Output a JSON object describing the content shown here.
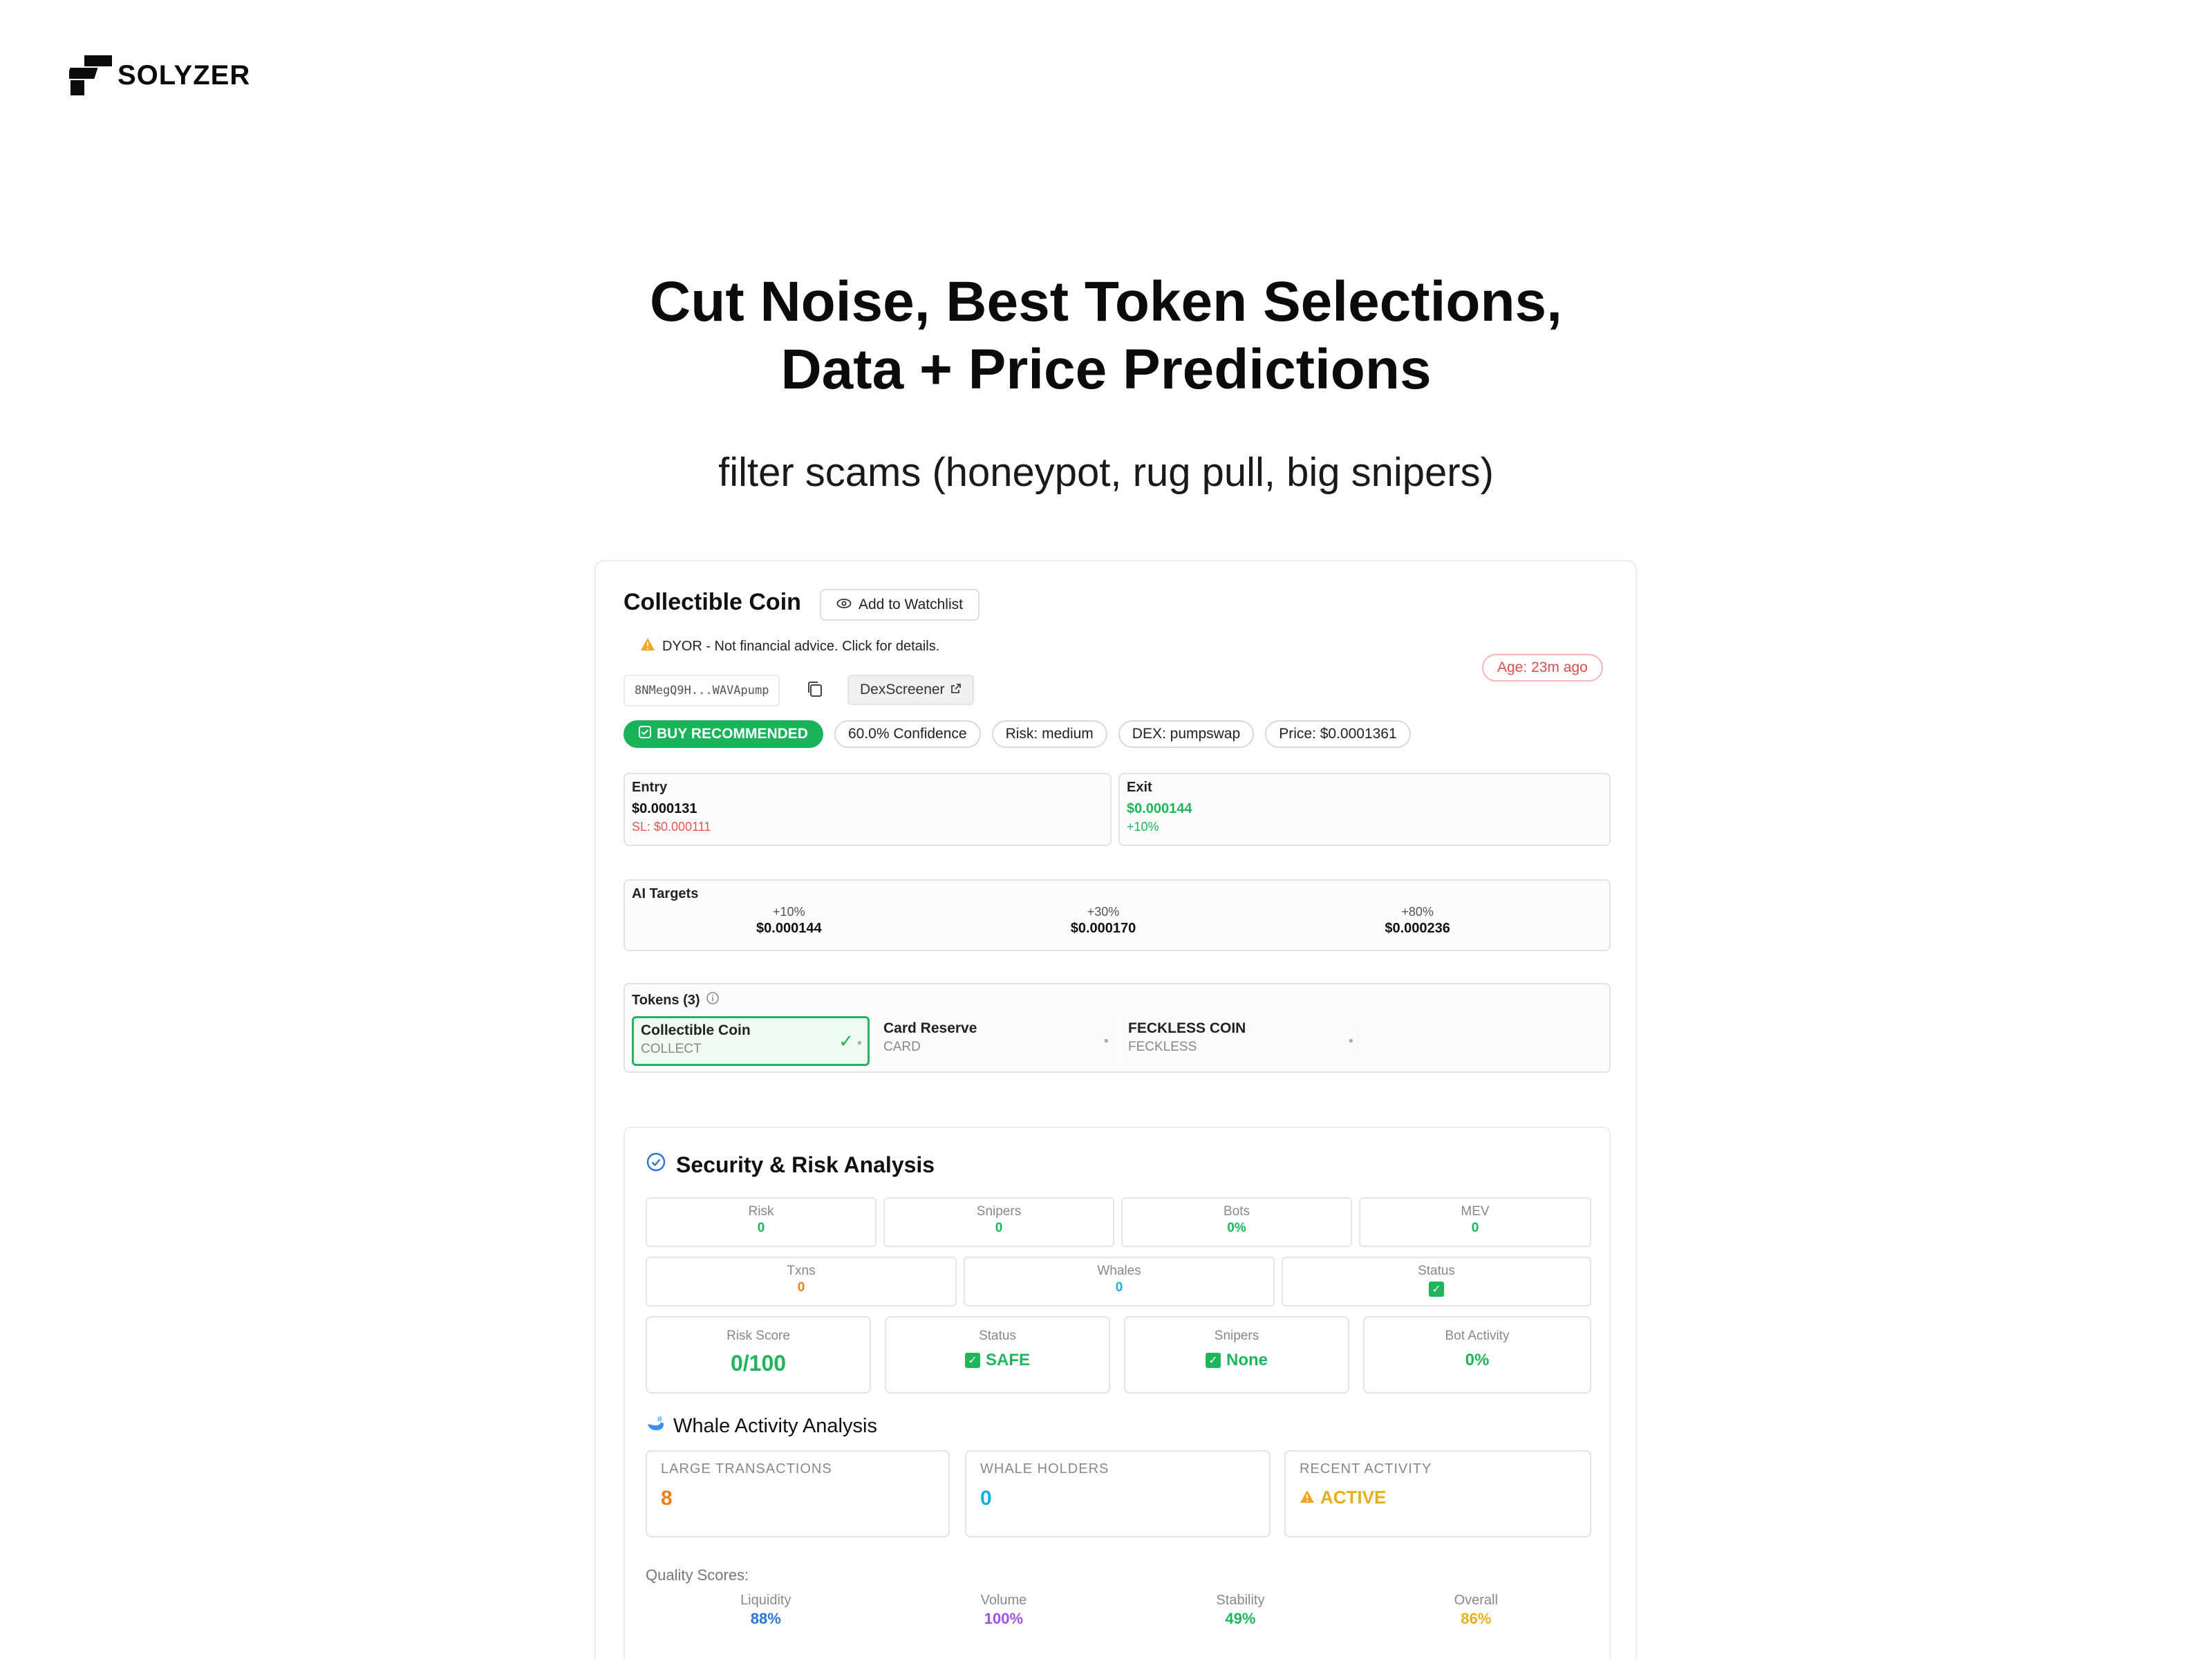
{
  "brand": {
    "name": "SOLYZER"
  },
  "hero": {
    "title_line1": "Cut Noise, Best Token Selections,",
    "title_line2": "Data + Price Predictions",
    "subtitle": "filter scams (honeypot, rug pull, big snipers)"
  },
  "token": {
    "name": "Collectible Coin",
    "watchlist_label": "Add to Watchlist",
    "dyor_text": "DYOR - Not financial advice. Click for details.",
    "age": "Age: 23m ago",
    "address": "8NMegQ9H...WAVApump",
    "dexscreener_label": "DexScreener"
  },
  "badges": {
    "buy": "BUY RECOMMENDED",
    "confidence": "60.0% Confidence",
    "risk": "Risk: medium",
    "dex": "DEX: pumpswap",
    "price": "Price: $0.0001361"
  },
  "entry": {
    "label": "Entry",
    "value": "$0.000131",
    "stop_loss": "SL: $0.000111"
  },
  "exit": {
    "label": "Exit",
    "value": "$0.000144",
    "change": "+10%"
  },
  "ai_targets": {
    "label": "AI Targets",
    "items": [
      {
        "pct": "+10%",
        "price": "$0.000144"
      },
      {
        "pct": "+30%",
        "price": "$0.000170"
      },
      {
        "pct": "+80%",
        "price": "$0.000236"
      }
    ]
  },
  "tokens": {
    "header": "Tokens (3)",
    "items": [
      {
        "name": "Collectible Coin",
        "symbol": "COLLECT"
      },
      {
        "name": "Card Reserve",
        "symbol": "CARD"
      },
      {
        "name": "FECKLESS COIN",
        "symbol": "FECKLESS"
      }
    ]
  },
  "security": {
    "title": "Security & Risk Analysis",
    "row1": [
      {
        "label": "Risk",
        "value": "0"
      },
      {
        "label": "Snipers",
        "value": "0"
      },
      {
        "label": "Bots",
        "value": "0%"
      },
      {
        "label": "MEV",
        "value": "0"
      }
    ],
    "row2": [
      {
        "label": "Txns",
        "value": "0"
      },
      {
        "label": "Whales",
        "value": "0"
      },
      {
        "label": "Status",
        "value": "✓"
      }
    ],
    "row3": [
      {
        "label": "Risk Score",
        "value": "0/100"
      },
      {
        "label": "Status",
        "value": "SAFE"
      },
      {
        "label": "Snipers",
        "value": "None"
      },
      {
        "label": "Bot Activity",
        "value": "0%"
      }
    ]
  },
  "whale": {
    "title": "Whale Activity Analysis",
    "items": [
      {
        "label": "LARGE TRANSACTIONS",
        "value": "8"
      },
      {
        "label": "WHALE HOLDERS",
        "value": "0"
      },
      {
        "label": "RECENT ACTIVITY",
        "value": "ACTIVE"
      }
    ]
  },
  "quality": {
    "label": "Quality Scores:",
    "items": [
      {
        "label": "Liquidity",
        "value": "88%"
      },
      {
        "label": "Volume",
        "value": "100%"
      },
      {
        "label": "Stability",
        "value": "49%"
      },
      {
        "label": "Overall",
        "value": "86%"
      }
    ]
  }
}
